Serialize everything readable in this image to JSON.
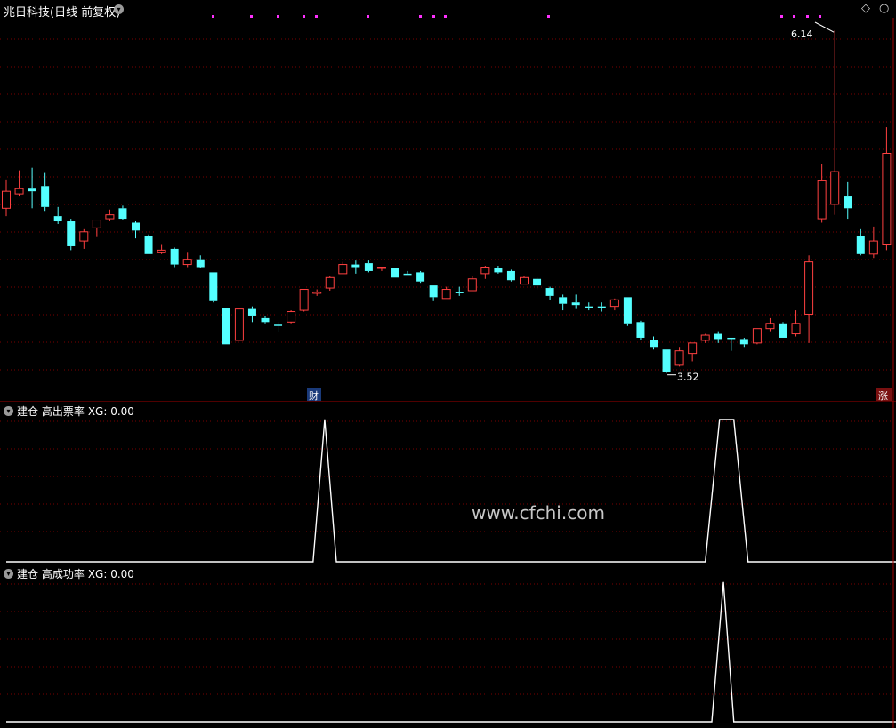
{
  "header": {
    "title": "兆日科技(日线 前复权)",
    "expand_icon": "chevron-down-icon",
    "right_icons": [
      "diamond-icon",
      "circle-icon"
    ]
  },
  "main_chart": {
    "high_label": "6.14",
    "low_label": "3.52",
    "marker_cai": "财",
    "marker_zhang": "涨"
  },
  "sub1": {
    "name": "建仓 高出票率",
    "xg": "XG: 0.00"
  },
  "sub2": {
    "name": "建仓 高成功率",
    "xg": "XG: 0.00"
  },
  "watermark": "www.cfchi.com",
  "colors": {
    "up": "#ff4040",
    "down": "#54ffff",
    "grid": "#7a0000",
    "dot": "#ff30ff",
    "signal": "#ffffff"
  },
  "chart_data": [
    {
      "type": "candlestick",
      "title": "兆日科技(日线 前复权)",
      "annotations": [
        {
          "text": "6.14",
          "kind": "high"
        },
        {
          "text": "3.52",
          "kind": "low"
        }
      ],
      "candles": [
        {
          "o": 4.78,
          "c": 4.91,
          "h": 5.0,
          "l": 4.72
        },
        {
          "o": 4.89,
          "c": 4.93,
          "h": 5.07,
          "l": 4.87
        },
        {
          "o": 4.93,
          "c": 4.91,
          "h": 5.09,
          "l": 4.78
        },
        {
          "o": 4.95,
          "c": 4.79,
          "h": 5.05,
          "l": 4.76
        },
        {
          "o": 4.72,
          "c": 4.68,
          "h": 4.79,
          "l": 4.66
        },
        {
          "o": 4.68,
          "c": 4.49,
          "h": 4.7,
          "l": 4.46
        },
        {
          "o": 4.53,
          "c": 4.6,
          "h": 4.62,
          "l": 4.47
        },
        {
          "o": 4.63,
          "c": 4.69,
          "h": 4.69,
          "l": 4.56
        },
        {
          "o": 4.7,
          "c": 4.73,
          "h": 4.77,
          "l": 4.68
        },
        {
          "o": 4.78,
          "c": 4.7,
          "h": 4.8,
          "l": 4.69
        },
        {
          "o": 4.67,
          "c": 4.61,
          "h": 4.68,
          "l": 4.55
        },
        {
          "o": 4.57,
          "c": 4.43,
          "h": 4.58,
          "l": 4.43
        },
        {
          "o": 4.44,
          "c": 4.46,
          "h": 4.5,
          "l": 4.43
        },
        {
          "o": 4.47,
          "c": 4.35,
          "h": 4.48,
          "l": 4.33
        },
        {
          "o": 4.35,
          "c": 4.39,
          "h": 4.44,
          "l": 4.33
        },
        {
          "o": 4.39,
          "c": 4.33,
          "h": 4.42,
          "l": 4.32
        },
        {
          "o": 4.29,
          "c": 4.07,
          "h": 4.29,
          "l": 4.06
        },
        {
          "o": 4.02,
          "c": 3.74,
          "h": 4.02,
          "l": 3.74
        },
        {
          "o": 3.77,
          "c": 4.01,
          "h": 4.01,
          "l": 3.77
        },
        {
          "o": 4.01,
          "c": 3.96,
          "h": 4.03,
          "l": 3.91
        },
        {
          "o": 3.94,
          "c": 3.91,
          "h": 3.96,
          "l": 3.9
        },
        {
          "o": 3.89,
          "c": 3.88,
          "h": 3.91,
          "l": 3.83
        },
        {
          "o": 3.91,
          "c": 3.99,
          "h": 4.0,
          "l": 3.9
        },
        {
          "o": 4.0,
          "c": 4.16,
          "h": 4.16,
          "l": 3.99
        },
        {
          "o": 4.13,
          "c": 4.14,
          "h": 4.16,
          "l": 4.11
        },
        {
          "o": 4.17,
          "c": 4.25,
          "h": 4.26,
          "l": 4.15
        },
        {
          "o": 4.28,
          "c": 4.35,
          "h": 4.37,
          "l": 4.28
        },
        {
          "o": 4.35,
          "c": 4.33,
          "h": 4.38,
          "l": 4.28
        },
        {
          "o": 4.36,
          "c": 4.3,
          "h": 4.38,
          "l": 4.29
        },
        {
          "o": 4.32,
          "c": 4.33,
          "h": 4.33,
          "l": 4.3
        },
        {
          "o": 4.32,
          "c": 4.25,
          "h": 4.32,
          "l": 4.25
        },
        {
          "o": 4.28,
          "c": 4.27,
          "h": 4.3,
          "l": 4.27
        },
        {
          "o": 4.29,
          "c": 4.22,
          "h": 4.3,
          "l": 4.21
        },
        {
          "o": 4.19,
          "c": 4.1,
          "h": 4.19,
          "l": 4.07
        },
        {
          "o": 4.09,
          "c": 4.16,
          "h": 4.18,
          "l": 4.09
        },
        {
          "o": 4.14,
          "c": 4.13,
          "h": 4.18,
          "l": 4.11
        },
        {
          "o": 4.15,
          "c": 4.24,
          "h": 4.26,
          "l": 4.15
        },
        {
          "o": 4.28,
          "c": 4.33,
          "h": 4.34,
          "l": 4.24
        },
        {
          "o": 4.32,
          "c": 4.29,
          "h": 4.34,
          "l": 4.28
        },
        {
          "o": 4.3,
          "c": 4.23,
          "h": 4.31,
          "l": 4.22
        },
        {
          "o": 4.2,
          "c": 4.25,
          "h": 4.26,
          "l": 4.2
        },
        {
          "o": 4.24,
          "c": 4.19,
          "h": 4.25,
          "l": 4.16
        },
        {
          "o": 4.17,
          "c": 4.11,
          "h": 4.18,
          "l": 4.08
        },
        {
          "o": 4.1,
          "c": 4.05,
          "h": 4.12,
          "l": 4.0
        },
        {
          "o": 4.06,
          "c": 4.04,
          "h": 4.12,
          "l": 4.01
        },
        {
          "o": 4.03,
          "c": 4.02,
          "h": 4.06,
          "l": 4.0
        },
        {
          "o": 4.03,
          "c": 4.02,
          "h": 4.06,
          "l": 3.99
        },
        {
          "o": 4.03,
          "c": 4.08,
          "h": 4.09,
          "l": 4.0
        },
        {
          "o": 4.1,
          "c": 3.9,
          "h": 4.1,
          "l": 3.88
        },
        {
          "o": 3.91,
          "c": 3.79,
          "h": 3.92,
          "l": 3.77
        },
        {
          "o": 3.77,
          "c": 3.72,
          "h": 3.8,
          "l": 3.7
        },
        {
          "o": 3.7,
          "c": 3.53,
          "h": 3.7,
          "l": 3.52
        },
        {
          "o": 3.58,
          "c": 3.69,
          "h": 3.72,
          "l": 3.57
        },
        {
          "o": 3.67,
          "c": 3.75,
          "h": 3.75,
          "l": 3.61
        },
        {
          "o": 3.77,
          "c": 3.81,
          "h": 3.82,
          "l": 3.75
        },
        {
          "o": 3.82,
          "c": 3.78,
          "h": 3.84,
          "l": 3.75
        },
        {
          "o": 3.79,
          "c": 3.78,
          "h": 3.79,
          "l": 3.69
        },
        {
          "o": 3.78,
          "c": 3.74,
          "h": 3.79,
          "l": 3.72
        },
        {
          "o": 3.75,
          "c": 3.86,
          "h": 3.86,
          "l": 3.74
        },
        {
          "o": 3.86,
          "c": 3.9,
          "h": 3.94,
          "l": 3.84
        },
        {
          "o": 3.9,
          "c": 3.79,
          "h": 3.91,
          "l": 3.79
        },
        {
          "o": 3.82,
          "c": 3.9,
          "h": 4.0,
          "l": 3.8
        },
        {
          "o": 3.97,
          "c": 4.37,
          "h": 4.42,
          "l": 3.75
        },
        {
          "o": 4.7,
          "c": 4.99,
          "h": 5.12,
          "l": 4.67
        },
        {
          "o": 4.81,
          "c": 5.06,
          "h": 6.14,
          "l": 4.73
        },
        {
          "o": 4.87,
          "c": 4.78,
          "h": 4.98,
          "l": 4.7
        },
        {
          "o": 4.57,
          "c": 4.43,
          "h": 4.62,
          "l": 4.42
        },
        {
          "o": 4.43,
          "c": 4.53,
          "h": 4.64,
          "l": 4.4
        },
        {
          "o": 4.5,
          "c": 5.2,
          "h": 5.4,
          "l": 4.46
        }
      ]
    },
    {
      "type": "line",
      "title": "建仓 高出票率",
      "series": [
        {
          "name": "XG",
          "values": [
            [
              0,
              0
            ],
            [
              23.7,
              0
            ],
            [
              24.6,
              1
            ],
            [
              25.5,
              0
            ],
            [
              54,
              0
            ],
            [
              55.1,
              1
            ],
            [
              56.2,
              1
            ],
            [
              57.3,
              0
            ],
            [
              69,
              0
            ]
          ]
        }
      ],
      "ylim": [
        0,
        1
      ]
    },
    {
      "type": "line",
      "title": "建仓 高成功率",
      "series": [
        {
          "name": "XG",
          "values": [
            [
              0,
              0
            ],
            [
              54.5,
              0
            ],
            [
              55.4,
              1
            ],
            [
              56.2,
              0
            ],
            [
              69,
              0
            ]
          ]
        }
      ],
      "ylim": [
        0,
        1
      ]
    }
  ]
}
